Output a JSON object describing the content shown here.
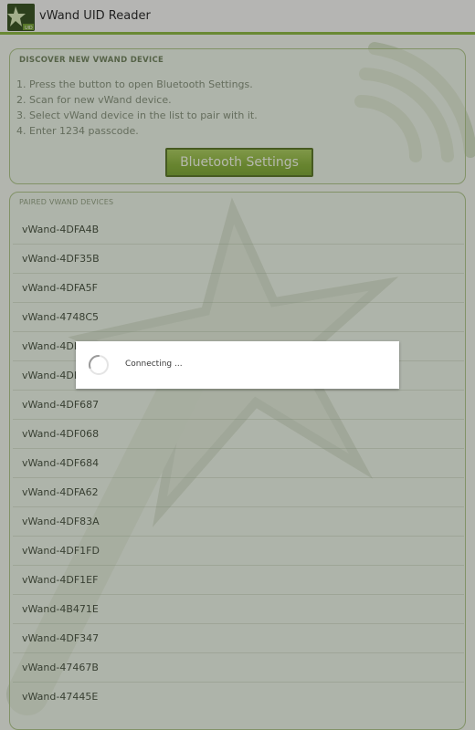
{
  "app": {
    "title": "vWand UID Reader",
    "icon": "vwand-app-icon"
  },
  "discover_panel": {
    "title": "DISCOVER NEW VWAND DEVICE",
    "steps": [
      "1. Press the button to open Bluetooth Settings.",
      "2. Scan for new vWand device.",
      "3. Select vWand device in the list to pair with it.",
      "4. Enter 1234 passcode."
    ],
    "bluetooth_button_label": "Bluetooth Settings"
  },
  "devices_panel": {
    "title": "PAIRED VWAND DEVICES",
    "items": [
      "vWand-4DFA4B",
      "vWand-4DF35B",
      "vWand-4DFA5F",
      "vWand-4748C5",
      "vWand-4DF",
      "vWand-4DF",
      "vWand-4DF687",
      "vWand-4DF068",
      "vWand-4DF684",
      "vWand-4DFA62",
      "vWand-4DF83A",
      "vWand-4DF1FD",
      "vWand-4DF1EF",
      "vWand-4B471E",
      "vWand-4DF347",
      "vWand-47467B",
      "vWand-47445E"
    ]
  },
  "dialog": {
    "message": "Connecting ...",
    "spinner_icon": "loading-spinner-icon"
  },
  "colors": {
    "accent": "#86b33a",
    "button_green": "#8cb33b",
    "panel_border": "#a9c083"
  }
}
